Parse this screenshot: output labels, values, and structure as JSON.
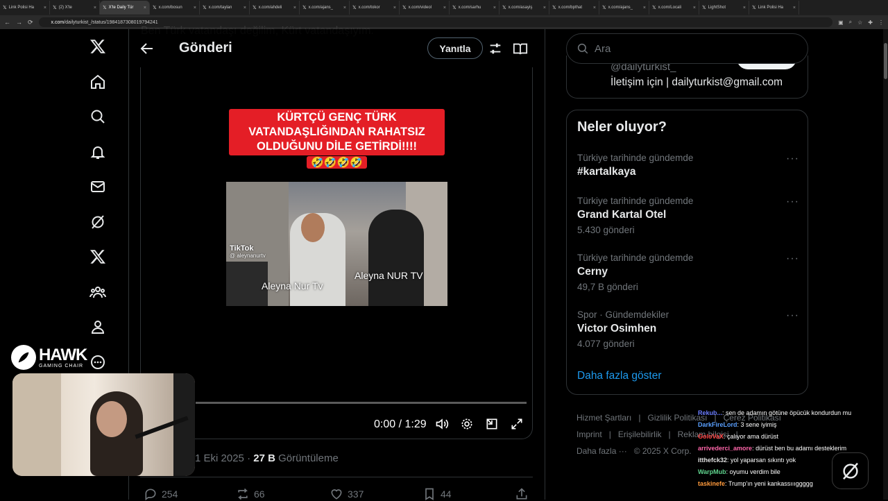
{
  "browser": {
    "tabs": [
      "Link Polisi Ha",
      "(2) X'te",
      "X'te Daily Tür",
      "x.com/bosun",
      "x.com/taylan",
      "x.com/ahdeli",
      "x.com/ajans_",
      "x.com/tokor",
      "x.com/videol",
      "x.com/sarhu",
      "x.com/asayiş",
      "x.com/bpthat",
      "x.com/ajans_",
      "x.com/Locali",
      "LightShot",
      "Link Polisi Ha"
    ],
    "url_domain": "x.com",
    "url_path": "/dailyturkist_/status/1984187308019794241"
  },
  "header": {
    "title": "Gönderi",
    "reply_label": "Yanıtla",
    "faded_text": "Ben Türk vatandaşı değilim, Kürt vatandaşıyım."
  },
  "post": {
    "caption": "KÜRTÇÜ GENÇ TÜRK VATANDAŞLIĞINDAN RAHATSIZ OLDUĞUNU DİLE GETİRDİ!!!!",
    "caption_emoji": "🤣🤣🤣🤣",
    "video_labels": {
      "left": "Aleyna Nur Tv",
      "right": "Aleyna NUR TV",
      "tiktok": "TikTok",
      "tiktok_handle": "@ aleynanurtv"
    },
    "video_time": "0:00 / 1:29",
    "progress": 0,
    "date": "1 Eki 2025",
    "separator": "·",
    "views_count": "27 B",
    "views_label": "Görüntüleme",
    "replies": "254",
    "reposts": "66",
    "likes": "337",
    "bookmarks": "44"
  },
  "right": {
    "search_placeholder": "Ara",
    "profile_handle": "@dailyturkist_",
    "profile_bio": "İletişim için | dailyturkist@gmail.com",
    "trends_title": "Neler oluyor?",
    "trends": [
      {
        "context": "Türkiye tarihinde gündemde",
        "name": "#kartalkaya",
        "count": ""
      },
      {
        "context": "Türkiye tarihinde gündemde",
        "name": "Grand Kartal Otel",
        "count": "5.430 gönderi"
      },
      {
        "context": "Türkiye tarihinde gündemde",
        "name": "Cerny",
        "count": "49,7 B gönderi"
      },
      {
        "context": "Spor · Gündemdekiler",
        "name": "Victor Osimhen",
        "count": "4.077 gönderi"
      }
    ],
    "more_glyph": "···",
    "show_more": "Daha fazla göster",
    "footer": [
      "Hizmet Şartları",
      "|",
      "Gizlilik Politikası",
      "|",
      "Çerez Politikası",
      "Imprint",
      "|",
      "Erişilebilirlik",
      "|",
      "Reklam bilgisi",
      "|",
      "Daha fazla ···",
      "© 2025 X Corp."
    ]
  },
  "overlay": {
    "brand_name": "HAWK",
    "brand_sub": "GAMING CHAIR",
    "chat": [
      {
        "user": "Rekub...",
        "color": "#6a7dff",
        "msg": ": sen de adamın götüne öpücük kondurdun mu"
      },
      {
        "user": "DarkFireLord",
        "color": "#5aa0ff",
        "msg": ": 3 sene iyimiş"
      },
      {
        "user": "GoloVaX",
        "color": "#ff4040",
        "msg": ": çalıyor ama dürüst"
      },
      {
        "user": "arrivederci_amore",
        "color": "#ff66aa",
        "msg": ": dürüst ben bu adamı desteklerim"
      },
      {
        "user": "itthefck32",
        "color": "#e0e0e0",
        "msg": ": yol yaparsan sıkıntı yok"
      },
      {
        "user": "WarpMub",
        "color": "#5fd38d",
        "msg": ": oyumu verdim bile"
      },
      {
        "user": "taskinefe",
        "color": "#ff9a3c",
        "msg": ": Trump'ın yeni kankassıııggggg"
      }
    ]
  }
}
